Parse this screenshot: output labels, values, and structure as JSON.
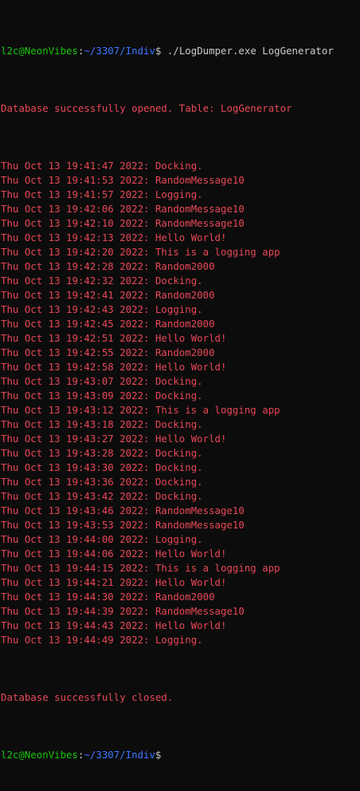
{
  "colors": {
    "background": "#0c0c0c",
    "user": "#16c60c",
    "path": "#3b78ff",
    "output": "#e74856",
    "command": "#cccccc"
  },
  "prompt_top": {
    "user_host": "l2c@NeonVibes",
    "colon": ":",
    "path": "~/3307/Indiv",
    "dollar": "$ ",
    "command": "./LogDumper.exe LogGenerator"
  },
  "opened_message": "Database successfully opened. Table: LogGenerator",
  "logs": [
    "Thu Oct 13 19:41:47 2022: Docking.",
    "Thu Oct 13 19:41:53 2022: RandomMessage10",
    "Thu Oct 13 19:41:57 2022: Logging.",
    "Thu Oct 13 19:42:06 2022: RandomMessage10",
    "Thu Oct 13 19:42:10 2022: RandomMessage10",
    "Thu Oct 13 19:42:13 2022: Hello World!",
    "Thu Oct 13 19:42:20 2022: This is a logging app",
    "Thu Oct 13 19:42:28 2022: Random2000",
    "Thu Oct 13 19:42:32 2022: Docking.",
    "Thu Oct 13 19:42:41 2022: Random2000",
    "Thu Oct 13 19:42:43 2022: Logging.",
    "Thu Oct 13 19:42:45 2022: Random2000",
    "Thu Oct 13 19:42:51 2022: Hello World!",
    "Thu Oct 13 19:42:55 2022: Random2000",
    "Thu Oct 13 19:42:58 2022: Hello World!",
    "Thu Oct 13 19:43:07 2022: Docking.",
    "Thu Oct 13 19:43:09 2022: Docking.",
    "Thu Oct 13 19:43:12 2022: This is a logging app",
    "Thu Oct 13 19:43:18 2022: Docking.",
    "Thu Oct 13 19:43:27 2022: Hello World!",
    "Thu Oct 13 19:43:28 2022: Docking.",
    "Thu Oct 13 19:43:30 2022: Docking.",
    "Thu Oct 13 19:43:36 2022: Docking.",
    "Thu Oct 13 19:43:42 2022: Docking.",
    "Thu Oct 13 19:43:46 2022: RandomMessage10",
    "Thu Oct 13 19:43:53 2022: RandomMessage10",
    "Thu Oct 13 19:44:00 2022: Logging.",
    "Thu Oct 13 19:44:06 2022: Hello World!",
    "Thu Oct 13 19:44:15 2022: This is a logging app",
    "Thu Oct 13 19:44:21 2022: Hello World!",
    "Thu Oct 13 19:44:30 2022: Random2000",
    "Thu Oct 13 19:44:39 2022: RandomMessage10",
    "Thu Oct 13 19:44:43 2022: Hello World!",
    "Thu Oct 13 19:44:49 2022: Logging."
  ],
  "closed_message": "Database successfully closed.",
  "prompt_bottom": {
    "user_host": "l2c@NeonVibes",
    "colon": ":",
    "path": "~/3307/Indiv",
    "dollar": "$"
  }
}
